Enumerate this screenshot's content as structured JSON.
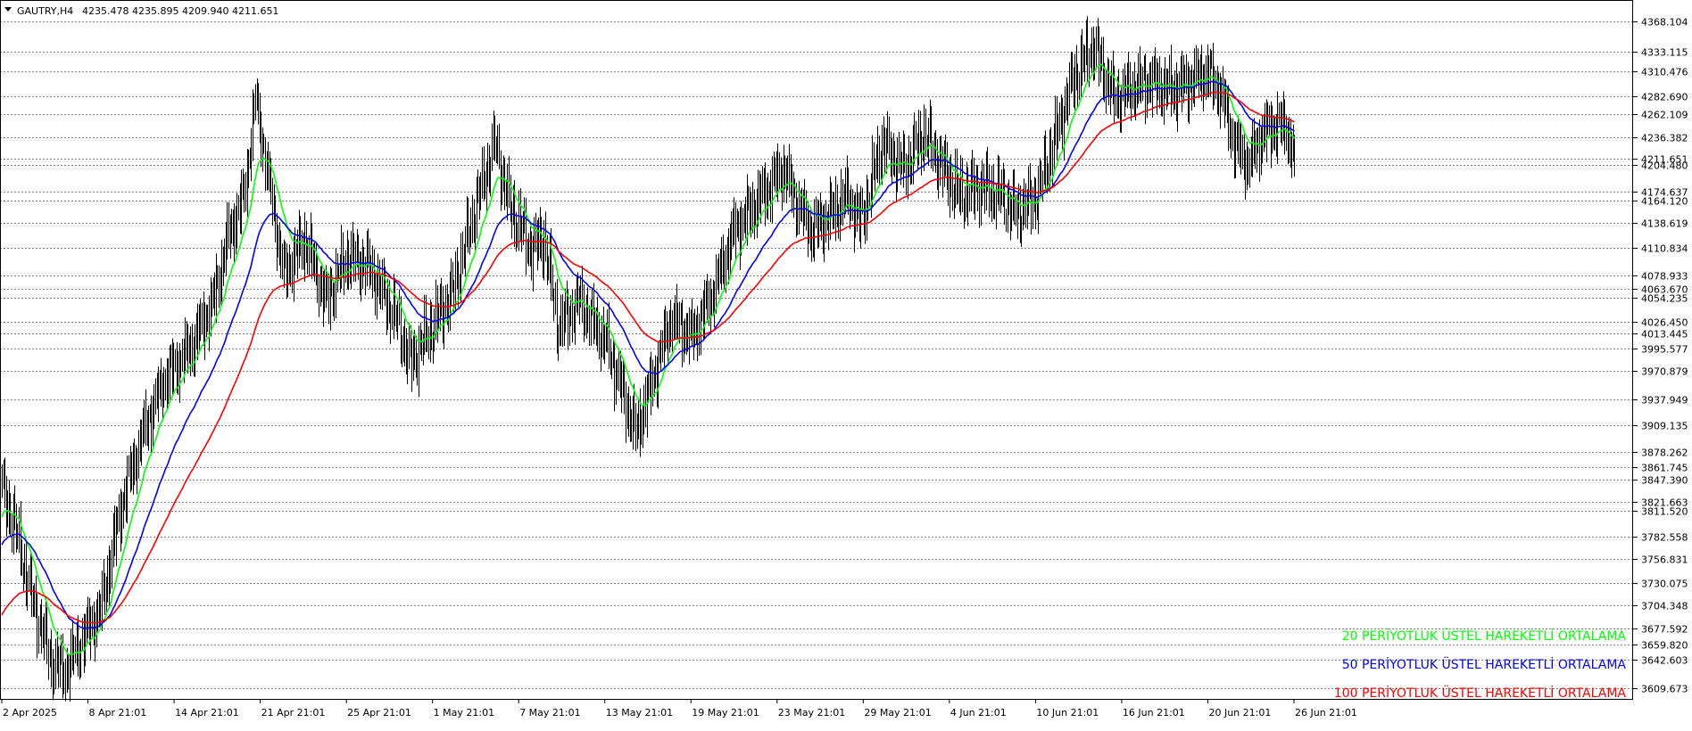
{
  "header": {
    "symbol": "GAUTRY,H4",
    "ohlc": "4235.478 4235.895 4209.940 4211.651"
  },
  "chart_data": {
    "type": "line",
    "ylim": [
      3598,
      4392
    ],
    "background": "#ffffff",
    "grid": "horizontal dashed",
    "price_levels": [
      "4368.104",
      "4333.115",
      "4310.476",
      "4282.690",
      "4262.109",
      "4236.382",
      "4211.651",
      "4204.480",
      "4174.637",
      "4164.120",
      "4138.619",
      "4110.834",
      "4078.933",
      "4063.670",
      "4054.235",
      "4026.450",
      "4013.445",
      "3995.577",
      "3970.879",
      "3937.949",
      "3909.135",
      "3878.262",
      "3861.745",
      "3847.390",
      "3821.663",
      "3811.520",
      "3782.558",
      "3756.831",
      "3730.075",
      "3704.348",
      "3677.592",
      "3659.820",
      "3642.603",
      "3609.673"
    ],
    "x_ticks": [
      "2 Apr 2025",
      "8 Apr 21:01",
      "14 Apr 21:01",
      "21 Apr 21:01",
      "25 Apr 21:01",
      "1 May 21:01",
      "7 May 21:01",
      "13 May 21:01",
      "19 May 21:01",
      "23 May 21:01",
      "29 May 21:01",
      "4 Jun 21:01",
      "10 Jun 21:01",
      "16 Jun 21:01",
      "20 Jun 21:01",
      "26 Jun 21:01"
    ],
    "key_closes": [
      [
        0,
        3835
      ],
      [
        8,
        3800
      ],
      [
        20,
        3720
      ],
      [
        35,
        3640
      ],
      [
        45,
        3630
      ],
      [
        55,
        3660
      ],
      [
        70,
        3700
      ],
      [
        85,
        3820
      ],
      [
        100,
        3900
      ],
      [
        115,
        3960
      ],
      [
        135,
        4000
      ],
      [
        150,
        4050
      ],
      [
        160,
        4120
      ],
      [
        172,
        4170
      ],
      [
        180,
        4280
      ],
      [
        188,
        4200
      ],
      [
        200,
        4080
      ],
      [
        215,
        4120
      ],
      [
        230,
        4050
      ],
      [
        245,
        4100
      ],
      [
        260,
        4090
      ],
      [
        280,
        4030
      ],
      [
        290,
        3980
      ],
      [
        305,
        4020
      ],
      [
        320,
        4060
      ],
      [
        335,
        4150
      ],
      [
        350,
        4230
      ],
      [
        360,
        4160
      ],
      [
        375,
        4110
      ],
      [
        385,
        4120
      ],
      [
        395,
        4020
      ],
      [
        410,
        4050
      ],
      [
        430,
        4000
      ],
      [
        450,
        3900
      ],
      [
        460,
        3950
      ],
      [
        475,
        4030
      ],
      [
        490,
        4010
      ],
      [
        505,
        4060
      ],
      [
        520,
        4130
      ],
      [
        540,
        4170
      ],
      [
        555,
        4200
      ],
      [
        565,
        4160
      ],
      [
        575,
        4130
      ],
      [
        590,
        4150
      ],
      [
        600,
        4170
      ],
      [
        610,
        4140
      ],
      [
        625,
        4230
      ],
      [
        640,
        4200
      ],
      [
        655,
        4240
      ],
      [
        665,
        4210
      ],
      [
        680,
        4170
      ],
      [
        695,
        4180
      ],
      [
        710,
        4170
      ],
      [
        720,
        4150
      ],
      [
        735,
        4170
      ],
      [
        745,
        4220
      ],
      [
        760,
        4300
      ],
      [
        775,
        4340
      ],
      [
        790,
        4280
      ],
      [
        800,
        4290
      ],
      [
        815,
        4300
      ],
      [
        830,
        4290
      ],
      [
        845,
        4300
      ],
      [
        855,
        4310
      ],
      [
        865,
        4290
      ],
      [
        875,
        4230
      ],
      [
        885,
        4205
      ],
      [
        895,
        4240
      ],
      [
        905,
        4250
      ],
      [
        912,
        4246
      ],
      [
        918,
        4212
      ]
    ],
    "series": [
      {
        "name": "20 PERİYOTLUK ÜSTEL HAREKETLİ ORTALAMA",
        "color": "#00ff00",
        "period": 20
      },
      {
        "name": "50 PERİYOTLUK ÜSTEL HAREKETLİ ORTALAMA",
        "color": "#0000ff",
        "period": 50
      },
      {
        "name": "100 PERİYOTLUK ÜSTEL HAREKETLİ ORTALAMA",
        "color": "#ff0000",
        "period": 100
      }
    ],
    "ema_seeds": [
      3800,
      3770,
      3690
    ]
  }
}
